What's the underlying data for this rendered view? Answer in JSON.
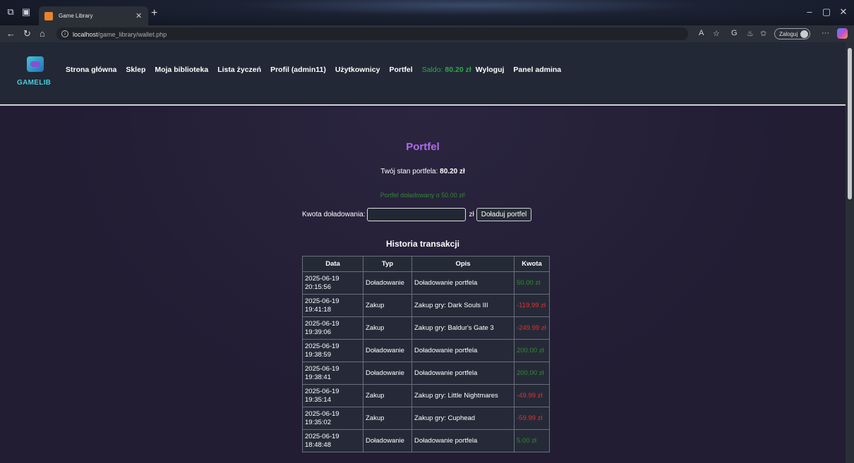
{
  "browser": {
    "tab_title": "Game Library",
    "url_host": "localhost",
    "url_path": "/game_library/wallet.php",
    "profile_label": "Zaloguj"
  },
  "site": {
    "logo_text": "GAMELIB",
    "nav": [
      "Strona główna",
      "Sklep",
      "Moja biblioteka",
      "Lista życzeń",
      "Profil (admin11)",
      "Użytkownicy",
      "Portfel"
    ],
    "saldo_label": "Saldo:",
    "saldo_value": "80.20 zł",
    "nav_after": [
      "Wyloguj",
      "Panel admina"
    ]
  },
  "wallet": {
    "title": "Portfel",
    "balance_label": "Twój stan portfela:",
    "balance_value": "80.20 zł",
    "message": "Portfel doładowany o 50.00 zł!",
    "topup_label": "Kwota doładowania:",
    "topup_value": "",
    "currency": "zł",
    "topup_button": "Doładuj portfel",
    "history_title": "Historia transakcji",
    "columns": [
      "Data",
      "Typ",
      "Opis",
      "Kwota"
    ],
    "rows": [
      {
        "date": "2025-06-19",
        "time": "20:15:56",
        "type": "Doładowanie",
        "desc": "Doładowanie portfela",
        "amount": "50.00 zł",
        "sign": "plus"
      },
      {
        "date": "2025-06-19",
        "time": "19:41:18",
        "type": "Zakup",
        "desc": "Zakup gry: Dark Souls III",
        "amount": "-119.99 zł",
        "sign": "minus"
      },
      {
        "date": "2025-06-19",
        "time": "19:39:06",
        "type": "Zakup",
        "desc": "Zakup gry: Baldur's Gate 3",
        "amount": "-249.99 zł",
        "sign": "minus"
      },
      {
        "date": "2025-06-19",
        "time": "19:38:59",
        "type": "Doładowanie",
        "desc": "Doładowanie portfela",
        "amount": "200.00 zł",
        "sign": "plus"
      },
      {
        "date": "2025-06-19",
        "time": "19:38:41",
        "type": "Doładowanie",
        "desc": "Doładowanie portfela",
        "amount": "200.00 zł",
        "sign": "plus"
      },
      {
        "date": "2025-06-19",
        "time": "19:35:14",
        "type": "Zakup",
        "desc": "Zakup gry: Little Nightmares",
        "amount": "-49.99 zł",
        "sign": "minus"
      },
      {
        "date": "2025-06-19",
        "time": "19:35:02",
        "type": "Zakup",
        "desc": "Zakup gry: Cuphead",
        "amount": "-59.99 zł",
        "sign": "minus"
      },
      {
        "date": "2025-06-19",
        "time": "18:48:48",
        "type": "Doładowanie",
        "desc": "Doładowanie portfela",
        "amount": "5.00 zł",
        "sign": "plus"
      }
    ]
  },
  "colors": {
    "accent": "#b26bf0",
    "positive": "#2e8b2e",
    "negative": "#e0312f",
    "saldo": "#2fa84a"
  }
}
